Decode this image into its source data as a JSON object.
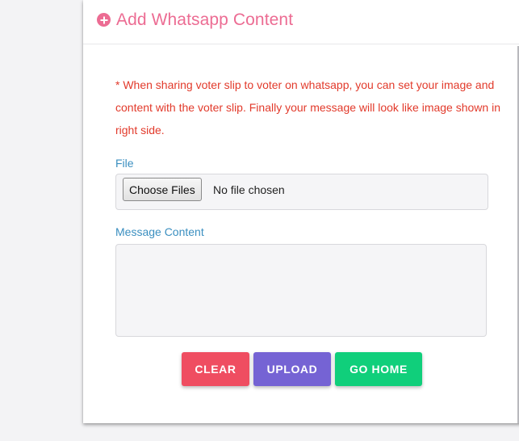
{
  "card": {
    "title": "Add Whatsapp Content",
    "notice": "* When sharing voter slip to voter on whatsapp, you can set your image and content with the voter slip. Finally your message will look like image shown in right side.",
    "file": {
      "label": "File",
      "button_label": "Choose Files",
      "status": "No file chosen"
    },
    "message": {
      "label": "Message Content",
      "value": ""
    },
    "buttons": {
      "clear": "CLEAR",
      "upload": "UPLOAD",
      "home": "GO HOME"
    }
  },
  "icons": {
    "header": "plus-circle-icon"
  },
  "colors": {
    "title": "#ec6c93",
    "notice": "#e23a2b",
    "label": "#3b8fc0",
    "clear": "#ef4d61",
    "upload": "#7563d4",
    "home": "#10cf7b",
    "background": "#f3f3f5"
  }
}
